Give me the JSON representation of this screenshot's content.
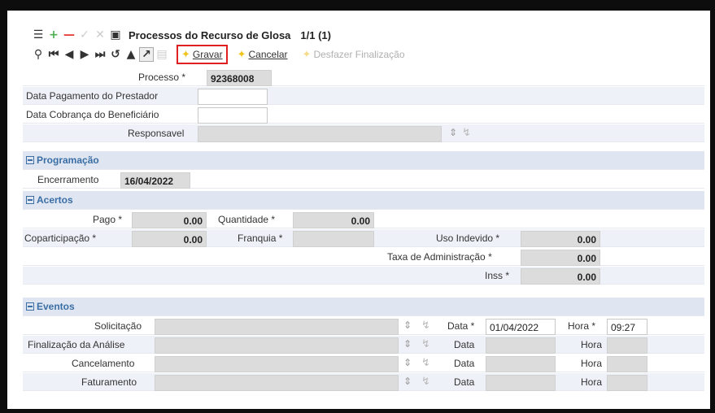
{
  "toolbar": {
    "title": "Processos do Recurso de Glosa",
    "counter": "1/1 (1)",
    "gravar": "Gravar",
    "cancelar": "Cancelar",
    "desfazer": "Desfazer Finalização"
  },
  "form": {
    "processo_label": "Processo *",
    "processo_value": "92368008",
    "data_pagamento_label": "Data Pagamento do Prestador",
    "data_cobranca_label": "Data Cobrança do Beneficiário",
    "responsavel_label": "Responsavel"
  },
  "programacao": {
    "section_title": "Programação",
    "encerramento_label": "Encerramento",
    "encerramento_value": "16/04/2022"
  },
  "acertos": {
    "section_title": "Acertos",
    "pago_label": "Pago *",
    "pago_value": "0.00",
    "quantidade_label": "Quantidade *",
    "quantidade_value": "0.00",
    "coparticipacao_label": "Coparticipação *",
    "coparticipacao_value": "0.00",
    "franquia_label": "Franquia *",
    "uso_indevido_label": "Uso Indevido *",
    "uso_indevido_value": "0.00",
    "taxa_label": "Taxa de Administração *",
    "taxa_value": "0.00",
    "inss_label": "Inss *",
    "inss_value": "0.00"
  },
  "eventos": {
    "section_title": "Eventos",
    "data_label_req": "Data *",
    "hora_label_req": "Hora *",
    "data_label": "Data",
    "hora_label": "Hora",
    "solicitacao_label": "Solicitação",
    "solicitacao_data": "01/04/2022",
    "solicitacao_hora": "09:27",
    "finalizacao_label": "Finalização da Análise",
    "cancelamento_label": "Cancelamento",
    "faturamento_label": "Faturamento"
  },
  "icons": {
    "list": "list-icon",
    "add": "plus-icon",
    "remove": "minus-icon",
    "confirm": "check-icon",
    "cancel": "x-icon",
    "export": "export-icon",
    "search": "search-icon",
    "first": "first-icon",
    "prev": "prev-icon",
    "next": "next-icon",
    "last": "last-icon",
    "refresh": "refresh-icon",
    "lock": "lock-icon",
    "link": "link-icon",
    "doc": "doc-icon",
    "bolt": "bolt-icon"
  },
  "colors": {
    "section_title": "#3a6ea5",
    "highlight": "#e02020",
    "bolt": "#f0c419"
  }
}
